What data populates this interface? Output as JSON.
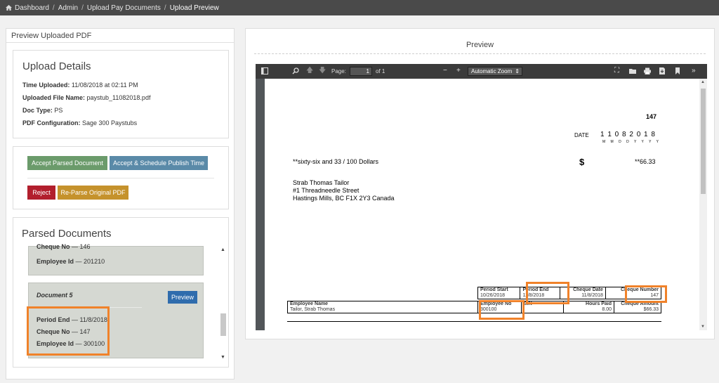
{
  "breadcrumb": [
    "Dashboard",
    "Admin",
    "Upload Pay Documents",
    "Upload Preview"
  ],
  "left_panel": {
    "header": "Preview Uploaded PDF",
    "upload_details": {
      "title": "Upload Details",
      "time_label": "Time Uploaded:",
      "time_value": "11/08/2018 at 02:11 PM",
      "file_label": "Uploaded File Name:",
      "file_value": "paystub_11082018.pdf",
      "doctype_label": "Doc Type:",
      "doctype_value": "PS",
      "config_label": "PDF Configuration:",
      "config_value": "Sage 300 Paystubs"
    },
    "actions": {
      "accept": "Accept Parsed Document",
      "accept_schedule": "Accept & Schedule Publish Time",
      "reject": "Reject",
      "reparse": "Re-Parse Original PDF"
    },
    "parsed": {
      "title": "Parsed Documents",
      "doc4": {
        "cheque_label": "Cheque No",
        "cheque_value": "146",
        "employee_label": "Employee Id",
        "employee_value": "201210"
      },
      "doc5": {
        "title": "Document 5",
        "preview": "Preview",
        "period_label": "Period End",
        "period_value": "11/8/2018",
        "cheque_label": "Cheque No",
        "cheque_value": "147",
        "employee_label": "Employee Id",
        "employee_value": "300100"
      },
      "dash": "—"
    }
  },
  "right_panel": {
    "title": "Preview",
    "viewer": {
      "page_label": "Page:",
      "page_current": "1",
      "page_total": "of 1",
      "zoom": "Automatic Zoom"
    },
    "cheque": {
      "number": "147",
      "date_label": "DATE",
      "date_digits": "1 1 0 8 2 0 1 8",
      "date_format": "M M D D Y Y Y Y",
      "amount_words": "**sixty-six and 33 / 100 Dollars",
      "dollar": "$",
      "amount": "**66.33",
      "payee_name": "Strab  Thomas  Tailor",
      "payee_street": "#1 Threadneedle Street",
      "payee_city": "Hastings Mills, BC F1X 2Y3 Canada"
    },
    "stub": {
      "period_start_label": "Period Start",
      "period_start": "10/26/2018",
      "period_end_label": "Period End",
      "period_end": "11/8/2018",
      "cheque_date_label": "Cheque Date",
      "cheque_date": "11/8/2018",
      "cheque_number_label": "Cheque Number",
      "cheque_number": "147",
      "employee_name_label": "Employee Name",
      "employee_name": "Tailor, Strab Thomas",
      "employee_no_label": "Employee No",
      "employee_no": "300100",
      "sin_label": "SIN",
      "hours_paid_label": "Hours Paid",
      "hours_paid": "8.00",
      "cheque_amount_label": "Cheque Amount",
      "cheque_amount": "$66.33"
    }
  },
  "colors": {
    "highlight": "#f0822a",
    "accept": "#6b9b6b",
    "schedule": "#5a8aa8",
    "reject": "#b21f2d",
    "reparse": "#c5922c",
    "preview_button": "#2f6cad"
  }
}
